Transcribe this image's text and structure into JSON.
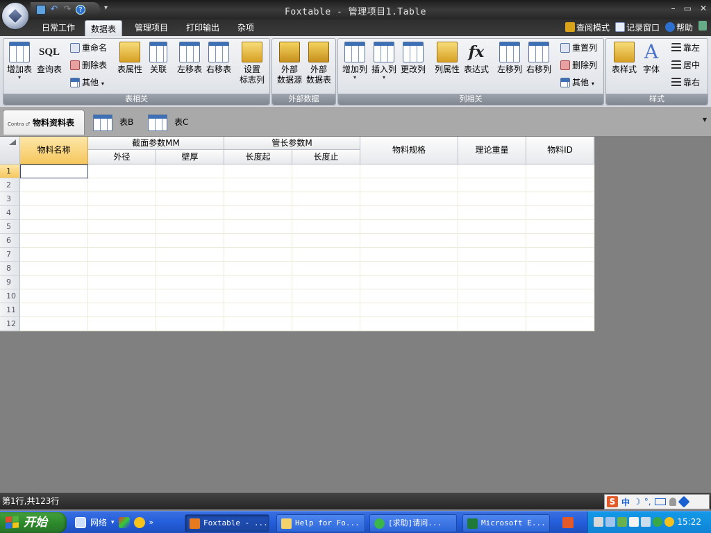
{
  "window": {
    "title": "Foxtable - 管理项目1.Table",
    "controls": [
      "–",
      "▭",
      "✕"
    ]
  },
  "ribbon_tabs": [
    "日常工作",
    "数据表",
    "管理项目",
    "打印输出",
    "杂项"
  ],
  "active_ribbon_tab": "数据表",
  "tab_right": {
    "view_mode": "查阅模式",
    "record_window": "记录窗口",
    "help": "帮助"
  },
  "groups": {
    "table": {
      "label": "表相关",
      "add_table": "增加表",
      "sql_icon_text": "SQL",
      "query_table": "查询表",
      "rename": "重命名",
      "delete_table": "删除表",
      "other": "其他",
      "table_props": "表属性",
      "relation": "关联",
      "move_left": "左移表",
      "move_right": "右移表",
      "set_flag_col_1": "设置",
      "set_flag_col_2": "标志列"
    },
    "external": {
      "label": "外部数据",
      "ext_source_1": "外部",
      "ext_source_2": "数据源",
      "ext_table_1": "外部",
      "ext_table_2": "数据表"
    },
    "column": {
      "label": "列相关",
      "add_col": "增加列",
      "insert_col": "插入列",
      "change_col": "更改列",
      "col_props": "列属性",
      "fx_icon_text": "fx",
      "expression": "表达式",
      "move_left": "左移列",
      "move_right": "右移列",
      "reset_col": "重置列",
      "delete_col": "删除列",
      "other": "其他"
    },
    "style": {
      "label": "样式",
      "table_style": "表样式",
      "a_icon_text": "A",
      "font": "字体",
      "align_left": "靠左",
      "align_center": "居中",
      "align_right": "靠右"
    }
  },
  "doc_tabs": {
    "active": {
      "logo": "Contra ♂",
      "label": "物料资料表"
    },
    "tab_b": "表B",
    "tab_c": "表C"
  },
  "grid": {
    "columns": {
      "name": "物料名称",
      "section_group": "截面参数MM",
      "outer_diameter": "外径",
      "wall_thickness": "壁厚",
      "length_group": "管长参数M",
      "length_start": "长度起",
      "length_end": "长度止",
      "spec": "物料规格",
      "theoretical_weight": "理论重量",
      "material_id": "物料ID"
    },
    "row_numbers": [
      "1",
      "2",
      "3",
      "4",
      "5",
      "6",
      "7",
      "8",
      "9",
      "10",
      "11",
      "12"
    ]
  },
  "status": {
    "text": "第1行,共123行"
  },
  "ime": {
    "s": "S",
    "zh": "中",
    "moon": "☽",
    "punct": "°,"
  },
  "taskbar": {
    "start": "开始",
    "network": "网络",
    "more": "»",
    "buttons": [
      "Foxtable - ...",
      "Help for Fo...",
      "[求助]请问...",
      "Microsoft E..."
    ],
    "clock": "15:22"
  },
  "colors": {
    "accent_header_selected": "#f6c75e",
    "taskbar": "#245edb",
    "start_green": "#2e8b2b"
  }
}
